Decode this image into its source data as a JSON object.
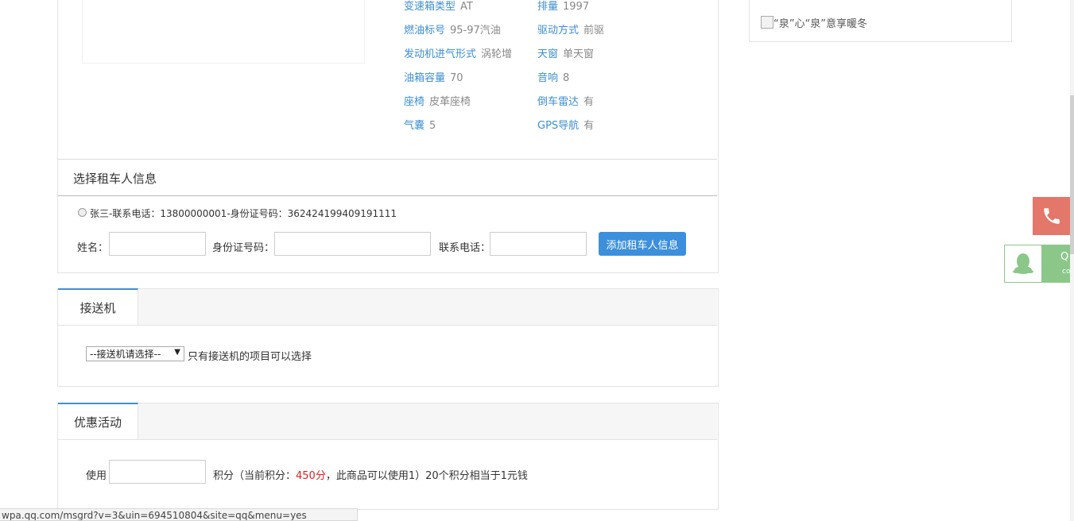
{
  "specs": [
    {
      "k": "变速箱类型",
      "v": "AT"
    },
    {
      "k": "排量",
      "v": "1997"
    },
    {
      "k": "燃油标号",
      "v": "95-97汽油"
    },
    {
      "k": "驱动方式",
      "v": "前驱"
    },
    {
      "k": "发动机进气形式",
      "v": "涡轮增"
    },
    {
      "k": "天窗",
      "v": "单天窗"
    },
    {
      "k": "油箱容量",
      "v": "70"
    },
    {
      "k": "音响",
      "v": "8"
    },
    {
      "k": "座椅",
      "v": "皮革座椅"
    },
    {
      "k": "倒车雷达",
      "v": "有"
    },
    {
      "k": "气囊",
      "v": "5"
    },
    {
      "k": "GPS导航",
      "v": "有"
    }
  ],
  "renter": {
    "title": "选择租车人信息",
    "existing": "张三-联系电话：13800000001-身份证号码：362424199409191111",
    "name_label": "姓名：",
    "id_label": "身份证号码：",
    "phone_label": "联系电话：",
    "add_button": "添加租车人信息"
  },
  "pickup": {
    "tab": "接送机",
    "select_value": "--接送机请选择--",
    "note": "只有接送机的项目可以选择"
  },
  "promo": {
    "tab": "优惠活动",
    "use_label": "使用",
    "points_prefix": "积分（当前积分：",
    "points_value": "450分",
    "points_suffix": "，此商品可以使用1）20个积分相当于1元钱"
  },
  "sidebar": {
    "broken_image_alt": "“泉”心“泉”意享暖冬"
  },
  "float": {
    "qq_text": "Q",
    "qq_sub": "co"
  },
  "status_url": "wpa.qq.com/msgrd?v=3&uin=694510804&site=qq&menu=yes",
  "colors": {
    "accent": "#3c8fdb",
    "phone": "#e3776a",
    "qq": "#8cc78a",
    "points": "#e02020"
  }
}
